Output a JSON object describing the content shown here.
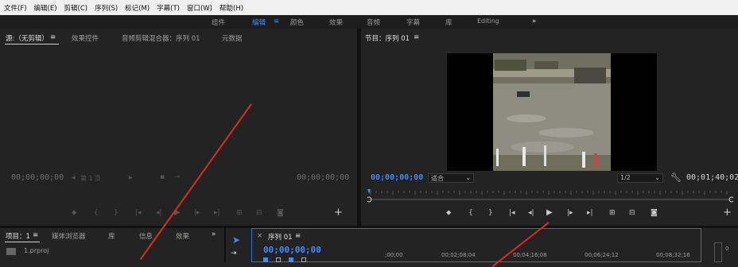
{
  "menu": [
    "文件(F)",
    "编辑(E)",
    "剪辑(C)",
    "序列(S)",
    "标记(M)",
    "字幕(T)",
    "窗口(W)",
    "帮助(H)"
  ],
  "workspaces": {
    "items": [
      "组件",
      "编辑",
      "颜色",
      "效果",
      "音频",
      "字幕",
      "库",
      "Editing"
    ],
    "active_index": 1,
    "overflow": "»"
  },
  "source_panel": {
    "tabs": [
      "源:（无剪辑）",
      "效果控件",
      "音频剪辑混合器：序列 01",
      "元数据"
    ],
    "timecode_left": "00;00;00;00",
    "page_label": "第 1 页",
    "timecode_right": "00;00;00;00"
  },
  "program_panel": {
    "title": "节目：序列 01",
    "timecode_left": "00;00;00;00",
    "fit_select": "适合",
    "quality_select": "1/2",
    "timecode_right": "00;01;40;02"
  },
  "project_panel": {
    "tabs": [
      "项目：1",
      "媒体浏览器",
      "库",
      "信息",
      "效果"
    ],
    "overflow": "»",
    "file": "1.prproj"
  },
  "timeline": {
    "tab": "序列 01",
    "close": "×",
    "timecode": "00;00;00;00",
    "ruler_labels": [
      ";00;00",
      "00;02;08;04",
      "00;04;16;08",
      "00;06;24;12",
      "00;08;32;16"
    ]
  },
  "audio_meter_label": "0",
  "colors": {
    "accent": "#3d8bff",
    "annotation": "#e02a1a",
    "timeline_border": "#2a6fd6"
  },
  "icons": [
    "menu-icon",
    "play-icon",
    "step-back-icon",
    "step-forward-icon",
    "go-to-in-icon",
    "go-to-out-icon",
    "mark-in-icon",
    "mark-out-icon",
    "add-marker-icon",
    "lift-icon",
    "extract-icon",
    "export-frame-icon",
    "plus-icon",
    "wrench-icon",
    "selection-tool-icon",
    "track-select-tool-icon"
  ]
}
